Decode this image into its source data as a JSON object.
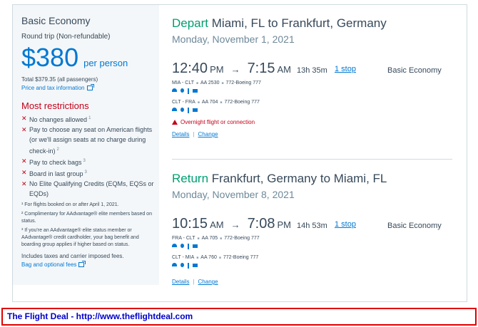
{
  "fare": {
    "title": "Basic Economy",
    "trip_type": "Round trip (Non-refundable)",
    "price": "$380",
    "per_person": "per person",
    "total": "Total $379.35 (all passengers)",
    "price_tax_link": "Price and tax information"
  },
  "restrictions": {
    "title": "Most restrictions",
    "items": [
      {
        "text": "No changes allowed",
        "ref": "1"
      },
      {
        "text": "Pay to choose any seat on American flights (or we'll assign seats at no charge during check-in)",
        "ref": "2"
      },
      {
        "text": "Pay to check bags",
        "ref": "3"
      },
      {
        "text": "Board in last group",
        "ref": "3"
      },
      {
        "text": "No Elite Qualifying Credits (EQMs, EQSs or EQDs)",
        "ref": ""
      }
    ],
    "footnotes": [
      "¹ For flights booked on or after April 1, 2021.",
      "² Complimentary for AAdvantage® elite members based on status.",
      "³ If you're an AAdvantage® elite status member or AAdvantage® credit cardholder, your bag benefit and boarding group applies if higher based on status."
    ],
    "taxes_note": "Includes taxes and carrier imposed fees.",
    "bag_fees_link": "Bag and optional fees"
  },
  "depart": {
    "direction": "Depart",
    "route": " Miami, FL to Frankfurt, Germany",
    "date": "Monday, November 1, 2021",
    "dep_time": "12:40",
    "dep_ampm": "PM",
    "arrow": "→",
    "arr_time": "7:15",
    "arr_ampm": "AM",
    "duration": "13h  35m",
    "stops": "1 stop",
    "cabin": "Basic Economy",
    "legs": [
      {
        "route": "MIA - CLT",
        "flight": "AA 2530",
        "aircraft": "772-Boeing 777"
      },
      {
        "route": "CLT - FRA",
        "flight": "AA 704",
        "aircraft": "772-Boeing 777"
      }
    ],
    "warning": "Overnight flight or connection",
    "details_link": "Details",
    "change_link": "Change",
    "link_sep": "|"
  },
  "return": {
    "direction": "Return",
    "route": " Frankfurt, Germany to Miami, FL",
    "date": "Monday, November 8, 2021",
    "dep_time": "10:15",
    "dep_ampm": "AM",
    "arrow": "→",
    "arr_time": "7:08",
    "arr_ampm": "PM",
    "duration": "14h  53m",
    "stops": "1 stop",
    "cabin": "Basic Economy",
    "legs": [
      {
        "route": "FRA - CLT",
        "flight": "AA 705",
        "aircraft": "772-Boeing 777"
      },
      {
        "route": "CLT - MIA",
        "flight": "AA 760",
        "aircraft": "772-Boeing 777"
      }
    ],
    "details_link": "Details",
    "change_link": "Change",
    "link_sep": "|"
  },
  "leg_separator": "■",
  "amenities": [
    "wifi-icon",
    "power-icon",
    "usb-icon",
    "entertainment-icon"
  ],
  "banner": {
    "text": "The Flight Deal - http://www.theflightdeal.com"
  },
  "colors": {
    "accent_blue": "#0078d2",
    "restriction_red": "#c30019",
    "direction_green": "#00a070",
    "banner_border": "#e00000",
    "banner_text": "#0000cc"
  }
}
